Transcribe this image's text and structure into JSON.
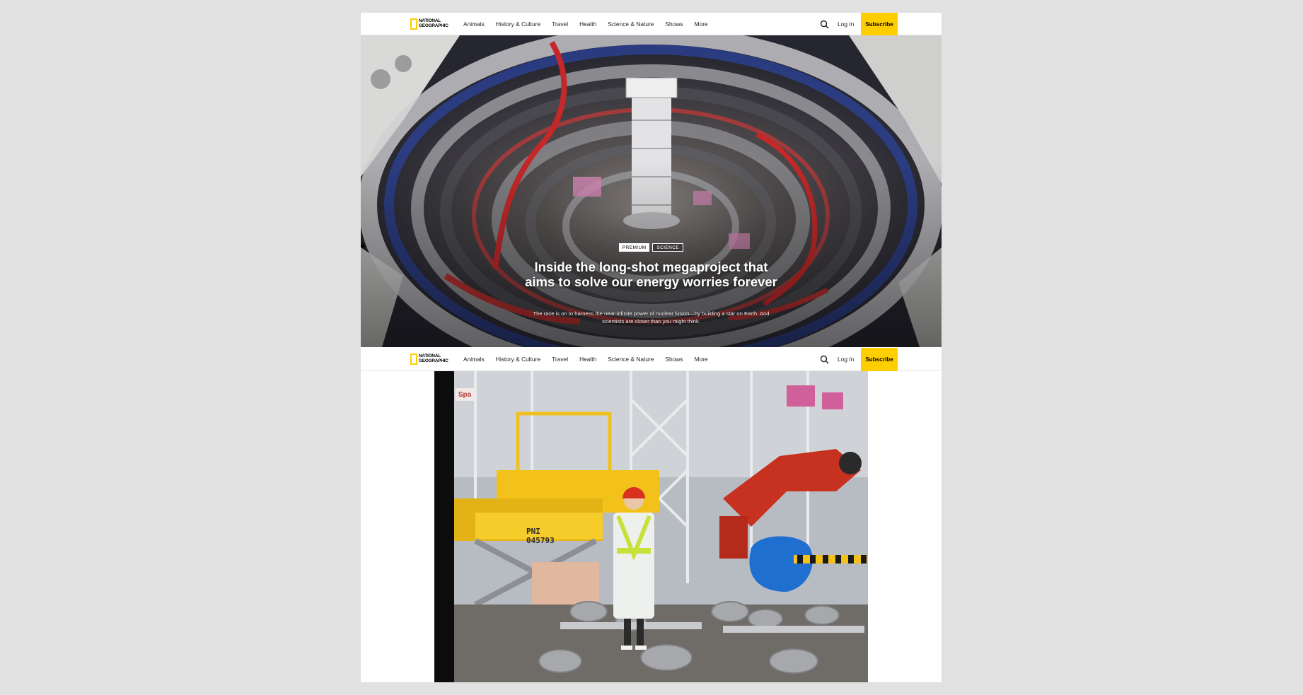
{
  "nav": {
    "logo_text_line1": "NATIONAL",
    "logo_text_line2": "GEOGRAPHIC",
    "items": [
      {
        "label": "Animals"
      },
      {
        "label": "History & Culture"
      },
      {
        "label": "Travel"
      },
      {
        "label": "Health"
      },
      {
        "label": "Science & Nature"
      },
      {
        "label": "Shows"
      },
      {
        "label": "More"
      }
    ],
    "login_label": "Log In",
    "subscribe_label": "Subscribe"
  },
  "hero": {
    "badge_premium": "PREMIUM",
    "badge_category": "SCIENCE",
    "title": "Inside the long-shot megaproject that aims to solve our energy worries forever",
    "subtitle": "The race is on to harness the near-infinite power of nuclear fusion—by building a star on Earth. And scientists are closer than you might think."
  },
  "photo": {
    "sign_text": "Spa",
    "pallet_line1": "PNI",
    "pallet_line2": "045793"
  },
  "colors": {
    "brand_yellow": "#ffce00",
    "nav_text": "#222222"
  }
}
